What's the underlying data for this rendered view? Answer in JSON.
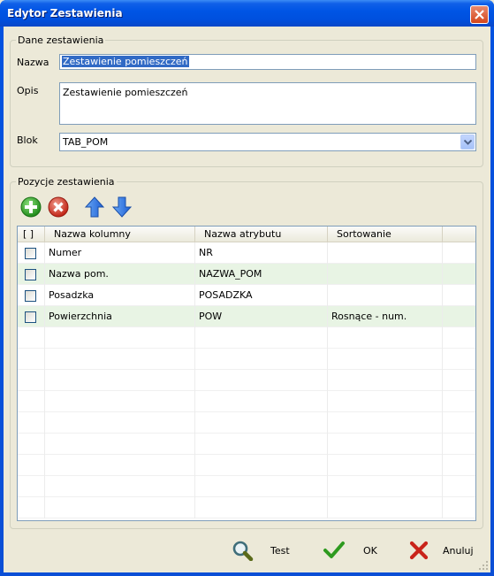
{
  "window": {
    "title": "Edytor Zestawienia"
  },
  "dane": {
    "legend": "Dane zestawienia",
    "nazwa_label": "Nazwa",
    "nazwa_value": "Zestawienie pomieszczeń",
    "opis_label": "Opis",
    "opis_value": "Zestawienie pomieszczeń",
    "blok_label": "Blok",
    "blok_value": "TAB_POM"
  },
  "pozycje": {
    "legend": "Pozycje zestawienia",
    "toolbar": [
      "add-icon",
      "delete-icon",
      "move-up-icon",
      "move-down-icon"
    ],
    "columns": [
      "[ ]",
      "Nazwa kolumny",
      "Nazwa atrybutu",
      "Sortowanie"
    ],
    "rows": [
      {
        "checked": false,
        "nazwa": "Numer",
        "atrybut": "NR",
        "sort": ""
      },
      {
        "checked": false,
        "nazwa": "Nazwa pom.",
        "atrybut": "NAZWA_POM",
        "sort": ""
      },
      {
        "checked": false,
        "nazwa": "Posadzka",
        "atrybut": "POSADZKA",
        "sort": ""
      },
      {
        "checked": false,
        "nazwa": "Powierzchnia",
        "atrybut": "POW",
        "sort": "Rosnące - num."
      }
    ]
  },
  "buttons": {
    "test": "Test",
    "ok": "OK",
    "cancel": "Anuluj"
  },
  "colors": {
    "row_alt": "#e8f4e4",
    "title_bar": "#0055e5",
    "selection": "#316ac5"
  }
}
